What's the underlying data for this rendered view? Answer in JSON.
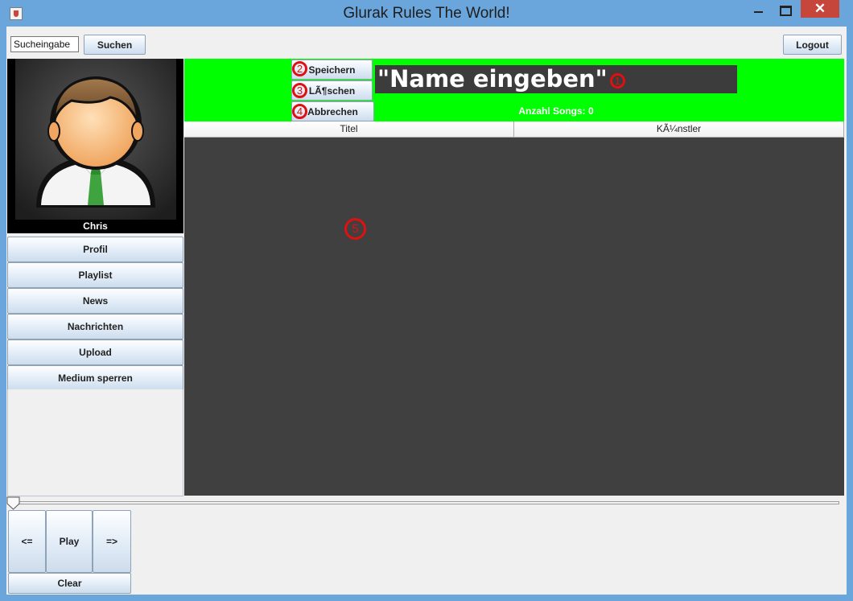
{
  "window": {
    "title": "Glurak Rules The World!",
    "close_symbol": "✕"
  },
  "toolbar": {
    "search_value": "Sucheingabe",
    "search_button": "Suchen",
    "logout_button": "Logout"
  },
  "profile": {
    "name": "Chris",
    "avatar_icon": "user-avatar-icon"
  },
  "sidebar": {
    "items": [
      {
        "label": "Profil"
      },
      {
        "label": "Playlist"
      },
      {
        "label": "News"
      },
      {
        "label": "Nachrichten"
      },
      {
        "label": "Upload"
      },
      {
        "label": "Medium sperren"
      }
    ]
  },
  "playlist_editor": {
    "save_button": "Speichern",
    "delete_button": "LÃ¶schen",
    "cancel_button": "Abbrechen",
    "name_value": "\"Name eingeben\"",
    "song_count": "Anzahl Songs: 0",
    "header_color": "#00ff00",
    "table_bg": "#404040"
  },
  "markers": [
    "1",
    "2",
    "3",
    "4",
    "5"
  ],
  "table": {
    "columns": [
      "Titel",
      "KÃ¼nstler"
    ],
    "rows": []
  },
  "player": {
    "prev_button": "<=",
    "play_button": "Play",
    "next_button": "=>",
    "clear_button": "Clear",
    "position": 0
  }
}
